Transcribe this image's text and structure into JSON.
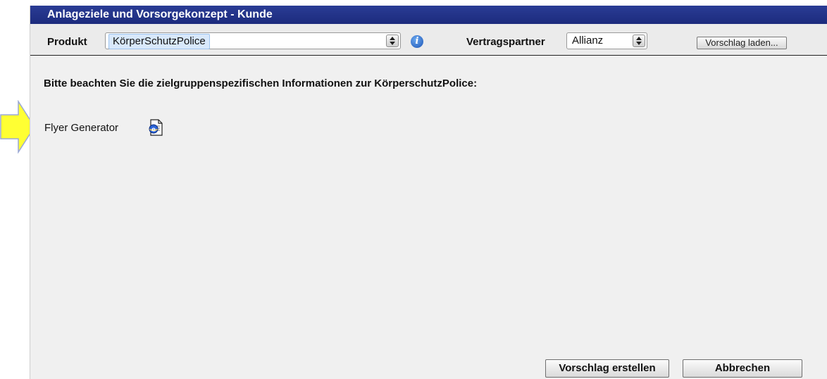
{
  "dialog": {
    "title": "Anlageziele und Vorsorgekonzept - Kunde"
  },
  "toolbar": {
    "produkt_label": "Produkt",
    "produkt_value": "KörperSchutzPolice",
    "vertragspartner_label": "Vertragspartner",
    "vertragspartner_value": "Allianz",
    "load_button": "Vorschlag laden..."
  },
  "content": {
    "notice": "Bitte beachten Sie die zielgruppenspezifischen Informationen zur KörperschutzPolice:",
    "flyer_label": "Flyer Generator"
  },
  "footer": {
    "create_button": "Vorschlag erstellen",
    "cancel_button": "Abbrechen"
  },
  "icons": {
    "info": "info-icon",
    "document": "document-icon",
    "pointer": "arrow-pointer-icon",
    "stepper": "stepper-icon"
  },
  "colors": {
    "titlebar": "#1c2b7d",
    "panel": "#f0f0f0",
    "arrow_fill": "#ffff33",
    "arrow_stroke": "#9aa7d6"
  }
}
